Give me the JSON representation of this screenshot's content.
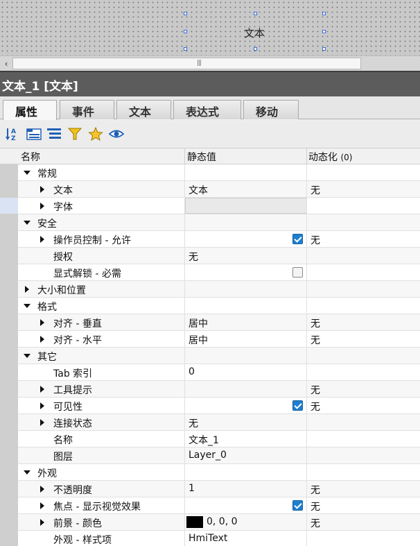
{
  "canvas": {
    "object_text": "文本"
  },
  "header": {
    "title": "文本_1 [文本]"
  },
  "tabs": [
    {
      "label": "属性",
      "active": true
    },
    {
      "label": "事件",
      "active": false
    },
    {
      "label": "文本",
      "active": false
    },
    {
      "label": "表达式",
      "active": false
    },
    {
      "label": "移动",
      "active": false
    }
  ],
  "toolbar": {
    "icons": [
      "sort-az-icon",
      "category-view-icon",
      "list-view-icon",
      "filter-icon",
      "favorite-star-icon",
      "eye-icon"
    ]
  },
  "table": {
    "columns": {
      "name": "名称",
      "static": "静态值",
      "dynamic": "动态化",
      "dynamic_count": "(0)"
    },
    "rows": [
      {
        "name": "常规",
        "static": "",
        "dynamic": ""
      },
      {
        "name": "文本",
        "static": "文本",
        "dynamic": "无"
      },
      {
        "name": "字体",
        "static": "",
        "dynamic": ""
      },
      {
        "name": "安全",
        "static": "",
        "dynamic": ""
      },
      {
        "name": "操作员控制 - 允许",
        "static": "",
        "dynamic": "无",
        "checked": true
      },
      {
        "name": "授权",
        "static": "无",
        "dynamic": ""
      },
      {
        "name": "显式解锁 - 必需",
        "static": "",
        "dynamic": "",
        "checked": false
      },
      {
        "name": "大小和位置",
        "static": "",
        "dynamic": ""
      },
      {
        "name": "格式",
        "static": "",
        "dynamic": ""
      },
      {
        "name": "对齐 - 垂直",
        "static": "居中",
        "dynamic": "无"
      },
      {
        "name": "对齐 - 水平",
        "static": "居中",
        "dynamic": "无"
      },
      {
        "name": "其它",
        "static": "",
        "dynamic": ""
      },
      {
        "name": "Tab 索引",
        "static": "0",
        "dynamic": ""
      },
      {
        "name": "工具提示",
        "static": "",
        "dynamic": "无"
      },
      {
        "name": "可见性",
        "static": "",
        "dynamic": "无",
        "checked": true
      },
      {
        "name": "连接状态",
        "static": "无",
        "dynamic": ""
      },
      {
        "name": "名称",
        "static": "文本_1",
        "dynamic": ""
      },
      {
        "name": "图层",
        "static": "Layer_0",
        "dynamic": ""
      },
      {
        "name": "外观",
        "static": "",
        "dynamic": ""
      },
      {
        "name": "不透明度",
        "static": "1",
        "dynamic": "无"
      },
      {
        "name": "焦点 - 显示视觉效果",
        "static": "",
        "dynamic": "无",
        "checked": true
      },
      {
        "name": "前景 - 颜色",
        "static": "0, 0, 0",
        "dynamic": "无",
        "swatch_color": "#000000"
      },
      {
        "name": "外观 - 样式项",
        "static": "HmiText",
        "dynamic": ""
      }
    ]
  }
}
